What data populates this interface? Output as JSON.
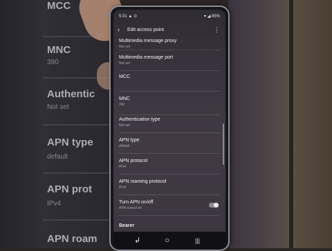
{
  "background": {
    "rows": [
      {
        "label": "MCC",
        "value": ""
      },
      {
        "label": "MNC",
        "value": "390"
      },
      {
        "label": "Authentic",
        "value": "Not set"
      },
      {
        "label": "APN type",
        "value": "default"
      },
      {
        "label": "APN prot",
        "value": "IPv4"
      },
      {
        "label": "APN roam",
        "value": ""
      }
    ]
  },
  "status_bar": {
    "time": "5:31 ▲ ⊙",
    "icons": "▾ ◢ 85%"
  },
  "app_bar": {
    "back_icon": "‹",
    "title": "Edit access point",
    "more_icon": "⋮"
  },
  "items": [
    {
      "label": "Multimedia message proxy",
      "value": "Not set"
    },
    {
      "label": "Multimedia message port",
      "value": "Not set"
    },
    {
      "label": "MCC",
      "value": ""
    },
    {
      "label": "MNC",
      "value": "390"
    },
    {
      "label": "Authentication type",
      "value": "Not set"
    },
    {
      "label": "APN type",
      "value": "default"
    },
    {
      "label": "APN protocol",
      "value": "IPv4"
    },
    {
      "label": "APN roaming protocol",
      "value": "IPv4"
    },
    {
      "label": "Turn APN on/off",
      "value": "APN turned on"
    }
  ],
  "apn_toggle": {
    "on": true
  },
  "section": {
    "bearer": "Bearer"
  },
  "navbar": {
    "recent": "↲",
    "home": "○",
    "back": "|||"
  }
}
